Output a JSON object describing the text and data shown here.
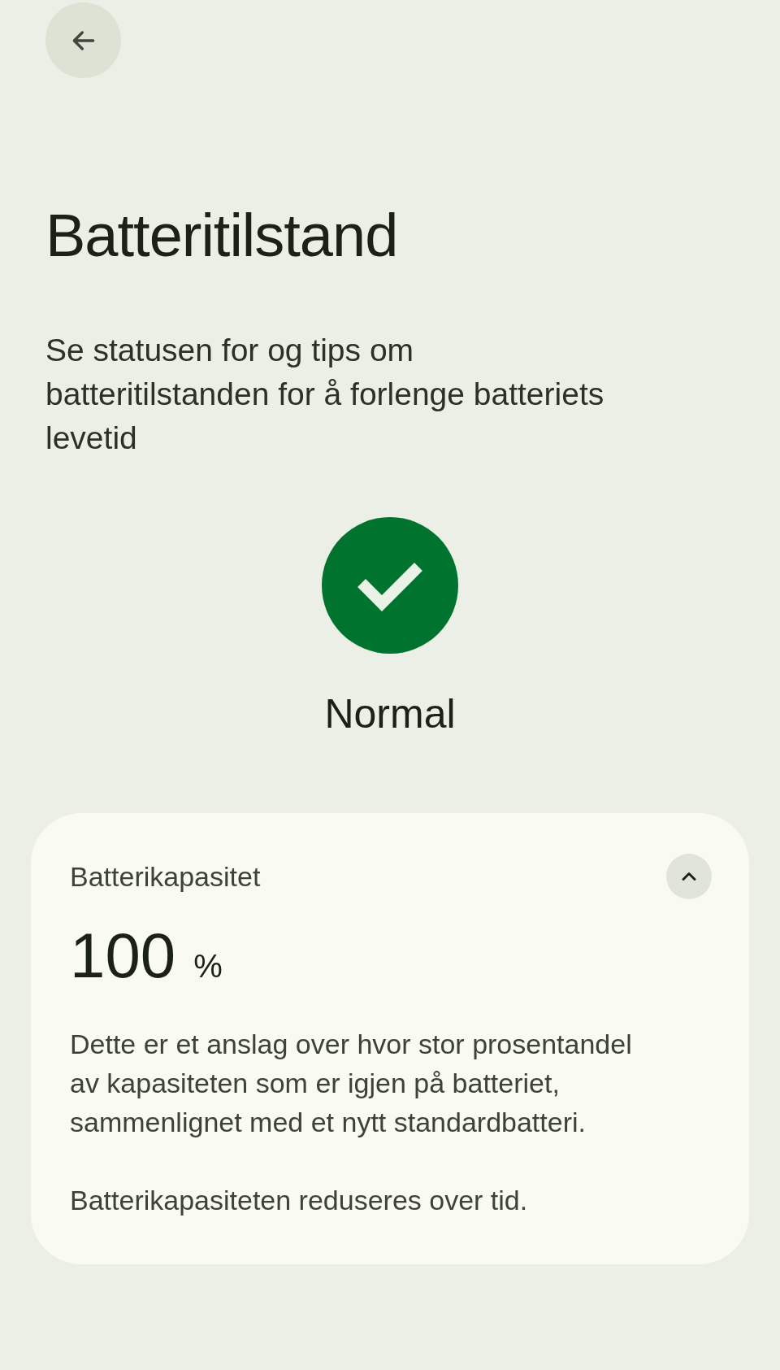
{
  "title": "Batteritilstand",
  "description": "Se statusen for og tips om batteritilstanden for å forlenge batteriets levetid",
  "status": {
    "label": "Normal"
  },
  "card": {
    "title": "Batterikapasitet",
    "expanded": true,
    "value": "100",
    "unit": "%",
    "paragraphs": [
      "Dette er et anslag over hvor stor prosentandel av kapasiteten som er igjen på batteriet, sammenlignet med et nytt standardbatteri.",
      "Batterikapasiteten reduseres over tid."
    ]
  }
}
